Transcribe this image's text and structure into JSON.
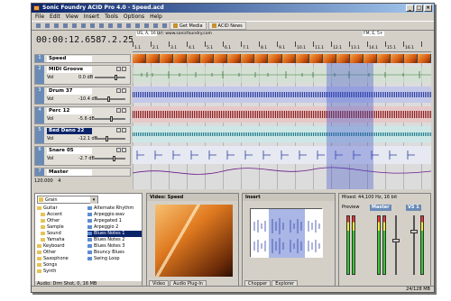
{
  "window": {
    "title": "Sonic Foundry ACID Pro 4.0 - Speed.acd",
    "controls": [
      "_",
      "□",
      "×"
    ]
  },
  "menu": [
    "File",
    "Edit",
    "View",
    "Insert",
    "Tools",
    "Options",
    "Help"
  ],
  "toolbar": {
    "get_media": "Get Media",
    "acid_news": "ACID News"
  },
  "time": {
    "position": "00:00:12.658",
    "measure": "7.2.258"
  },
  "ruler": {
    "markers": [
      "US, A, 16",
      "Url: www.sonicfoundry.com",
      "FM, E, 5+"
    ],
    "bars": [
      "1.1",
      "2.1",
      "3.1",
      "4.1",
      "5.1",
      "6.1",
      "7.1",
      "8.1",
      "9.1",
      "10.1",
      "11.1",
      "12.1",
      "13.1",
      "14.1",
      "15.1",
      "16.1"
    ]
  },
  "tracks": [
    {
      "num": "1",
      "name": "Speed",
      "vol_label": "",
      "value": ""
    },
    {
      "num": "2",
      "name": "MIDI Groove",
      "vol_label": "Vol",
      "value": "0.0 dB"
    },
    {
      "num": "3",
      "name": "Drum 37",
      "vol_label": "Vol",
      "value": "-10.4 dB"
    },
    {
      "num": "4",
      "name": "Perc 12",
      "vol_label": "Vol",
      "value": "-5.6 dB"
    },
    {
      "num": "5",
      "name": "Bed Dano 22",
      "vol_label": "Vol",
      "value": "-12.1 dB"
    },
    {
      "num": "6",
      "name": "Snare 05",
      "vol_label": "Vol",
      "value": "-2.7 dB"
    },
    {
      "num": "7",
      "name": "Master",
      "vol_label": "",
      "value": ""
    }
  ],
  "tempo": {
    "bpm": "120.000",
    "beat": "4"
  },
  "explorer": {
    "path": "Grain",
    "tree": [
      "Guitar",
      "Accent",
      "Other",
      "Sample",
      "Sound",
      "Yamaha",
      "Keyboard",
      "Other",
      "Saxophone",
      "Songs",
      "Synth"
    ],
    "files": [
      "Alternate Rhythm",
      "Arpeggio.wav",
      "Arpegated 1",
      "Arpeggio 2",
      "Blues Notes 1",
      "Blues Notes 2",
      "Blues Notes 3",
      "Bouncy Blues",
      "Swing Loop"
    ],
    "selected_file": "Blues Notes 1",
    "status": "Audio: Drm Shot, 0, 16 MB"
  },
  "video": {
    "title": "Video: Speed",
    "tabs": [
      "Video",
      "Audio Plug-In"
    ]
  },
  "editor": {
    "title": "Insert",
    "tabs": [
      "Chopper",
      "Explorer"
    ]
  },
  "mixer": {
    "header": "Mixed: 44,100 Hz, 16 bit",
    "preview": "Preview",
    "master": "Master",
    "fx": "VS 1"
  },
  "statusbar": {
    "memory": "24/128 MB"
  }
}
